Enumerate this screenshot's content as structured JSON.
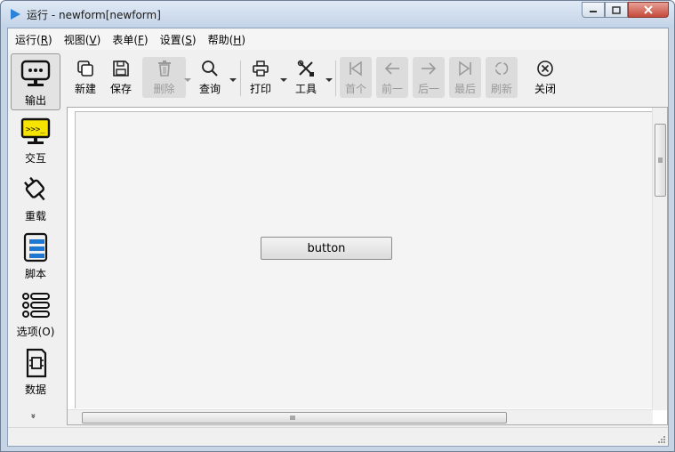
{
  "window": {
    "title": "运行 - newform[newform]"
  },
  "menu": [
    {
      "label": "运行(",
      "key": "R",
      "end": ")"
    },
    {
      "label": "视图(",
      "key": "V",
      "end": ")"
    },
    {
      "label": "表单(",
      "key": "F",
      "end": ")"
    },
    {
      "label": "设置(",
      "key": "S",
      "end": ")"
    },
    {
      "label": "帮助(",
      "key": "H",
      "end": ")"
    }
  ],
  "left_panel": [
    {
      "label": "输出",
      "icon": "monitor-icon"
    },
    {
      "label": "交互",
      "icon": "terminal-icon"
    },
    {
      "label": "重载",
      "icon": "plug-icon"
    },
    {
      "label": "脚本",
      "icon": "script-icon"
    },
    {
      "label": "选项(O)",
      "icon": "options-list-icon"
    },
    {
      "label": "数据",
      "icon": "chip-icon"
    }
  ],
  "left_panel_more": "»",
  "toolbar": {
    "new": "新建",
    "save": "保存",
    "delete": "删除",
    "query": "查询",
    "print": "打印",
    "tools": "工具",
    "first": "首个",
    "prev": "前一",
    "next": "后一",
    "last": "最后",
    "refresh": "刷新",
    "close": "关闭"
  },
  "form": {
    "button_label": "button"
  },
  "colors": {
    "titlebar": "#c3d3e7",
    "accent": "#1e78d2",
    "close_button": "#c5493a"
  }
}
